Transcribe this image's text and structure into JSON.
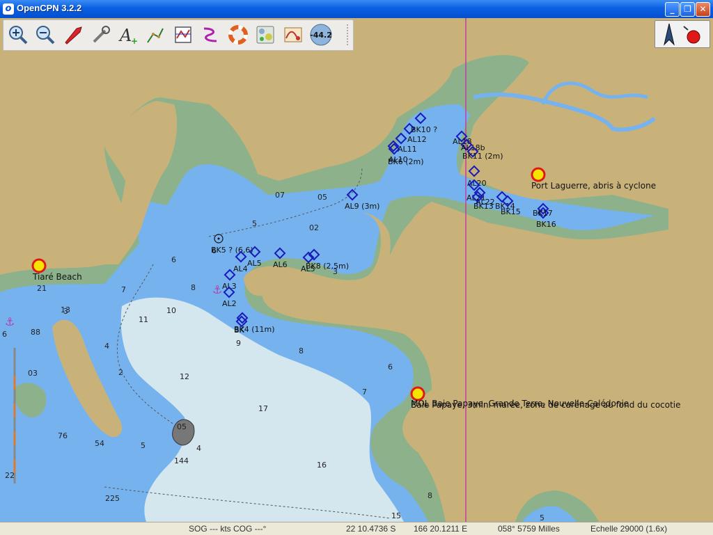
{
  "window": {
    "title": "OpenCPN 3.2.2",
    "app_icon": "opencpn-logo-icon",
    "min_label": "_",
    "max_label": "❐",
    "close_label": "✕"
  },
  "toolbar": {
    "items": [
      {
        "icon": "zoom-in-icon"
      },
      {
        "icon": "zoom-out-icon"
      },
      {
        "icon": "ship-icon"
      },
      {
        "icon": "settings-wrench-icon"
      },
      {
        "icon": "text-toggle-icon"
      },
      {
        "icon": "route-icon"
      },
      {
        "icon": "chart-quilt-icon"
      },
      {
        "icon": "track-icon"
      },
      {
        "icon": "mob-lifebuoy-icon"
      },
      {
        "icon": "ais-icon"
      },
      {
        "icon": "tides-icon"
      }
    ],
    "rotation_value": "-44.2"
  },
  "compass": {
    "north_icon": "north-arrow-icon",
    "gps_icon": "gps-status-icon"
  },
  "soundings": [
    {
      "v": "07"
    },
    {
      "v": "05"
    },
    {
      "v": "5"
    },
    {
      "v": "02"
    },
    {
      "v": "6"
    },
    {
      "v": "6"
    },
    {
      "v": "7"
    },
    {
      "v": "8"
    },
    {
      "v": "10"
    },
    {
      "v": "11"
    },
    {
      "v": "3"
    },
    {
      "v": "13"
    },
    {
      "v": "4"
    },
    {
      "v": "2"
    },
    {
      "v": "03"
    },
    {
      "v": "88"
    },
    {
      "v": "21"
    },
    {
      "v": "6"
    },
    {
      "v": "12"
    },
    {
      "v": "17"
    },
    {
      "v": "9"
    },
    {
      "v": "8"
    },
    {
      "v": "6"
    },
    {
      "v": "7"
    },
    {
      "v": "16"
    },
    {
      "v": "76"
    },
    {
      "v": "54"
    },
    {
      "v": "5"
    },
    {
      "v": "4"
    },
    {
      "v": "144"
    },
    {
      "v": "05"
    },
    {
      "v": "225"
    },
    {
      "v": "8"
    },
    {
      "v": "15"
    },
    {
      "v": "5"
    },
    {
      "v": "22"
    },
    {
      "v": "3"
    }
  ],
  "waypoints": [
    {
      "label": "BK5 ? (6,6)"
    },
    {
      "label": "AL4"
    },
    {
      "label": "AL5"
    },
    {
      "label": "AL6"
    },
    {
      "label": "AL3"
    },
    {
      "label": "AL2"
    },
    {
      "label": "AL5"
    },
    {
      "label": "BK8 (2,5m)"
    },
    {
      "label": "BK4 (11m)"
    },
    {
      "label": "BK"
    },
    {
      "label": "AL9 (3m)"
    },
    {
      "label": "AL12"
    },
    {
      "label": "AL11"
    },
    {
      "label": "AL10"
    },
    {
      "label": "BK6 (2m)"
    },
    {
      "label": "BK10 ?"
    },
    {
      "label": "AL18"
    },
    {
      "label": "AL18b"
    },
    {
      "label": "BK11 (2m)"
    },
    {
      "label": "AL20"
    },
    {
      "label": "AL21"
    },
    {
      "label": "AL22"
    },
    {
      "label": "BK13"
    },
    {
      "label": "BK14"
    },
    {
      "label": "BK15"
    },
    {
      "label": "BK16"
    },
    {
      "label": "BK17"
    }
  ],
  "marks": [
    {
      "label": "Tiaré Beach"
    },
    {
      "label": "Port Laguerre, abris à cyclone"
    },
    {
      "label": "MOL Baie Papaye, Grande Terre, Nouvelle-Calédonie"
    },
    {
      "label": "Baie Papaye, 3mini marée, zone de carénage au fond du cocotie"
    }
  ],
  "status": {
    "sog": "SOG --- kts  COG ---°",
    "lat": "22 10.4736 S",
    "lon": "166 20.1211 E",
    "bearing": "058°  5759 Milles",
    "scale": "Echelle 29000 (1.6x)"
  },
  "colors": {
    "land": "#c9b27a",
    "intertidal": "#8db18a",
    "shallow": "#76b3ee",
    "medium": "#a5d0f5",
    "deep": "#d4e6ee",
    "waypoint": "#1a1ab8",
    "route": "#c040a0"
  }
}
